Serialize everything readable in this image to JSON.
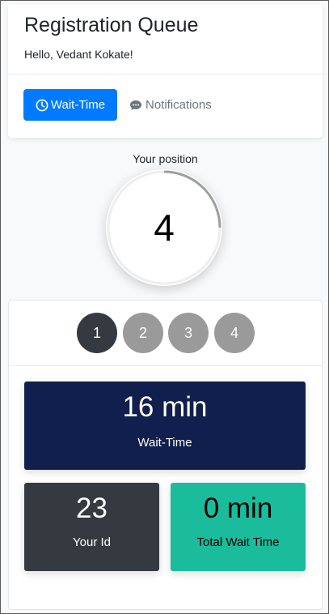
{
  "header": {
    "title": "Registration Queue",
    "greeting": "Hello, Vedant Kokate!"
  },
  "tabs": [
    {
      "label": "Wait-Time",
      "icon": "clock-icon",
      "active": true,
      "color": "#007bff"
    },
    {
      "label": "Notifications",
      "icon": "chat-icon",
      "active": false
    }
  ],
  "position": {
    "label": "Your position",
    "value": "4",
    "progress_fraction": 0.25
  },
  "steps": [
    {
      "label": "1",
      "active": true
    },
    {
      "label": "2",
      "active": false
    },
    {
      "label": "3",
      "active": false
    },
    {
      "label": "4",
      "active": false
    }
  ],
  "stats": {
    "wait_time": {
      "value": "16 min",
      "label": "Wait-Time",
      "color": "#101f4d"
    },
    "your_id": {
      "value": "23",
      "label": "Your Id",
      "color": "#343a40"
    },
    "total_wait": {
      "value": "0 min",
      "label": "Total Wait Time",
      "color": "#1abc9c"
    }
  }
}
